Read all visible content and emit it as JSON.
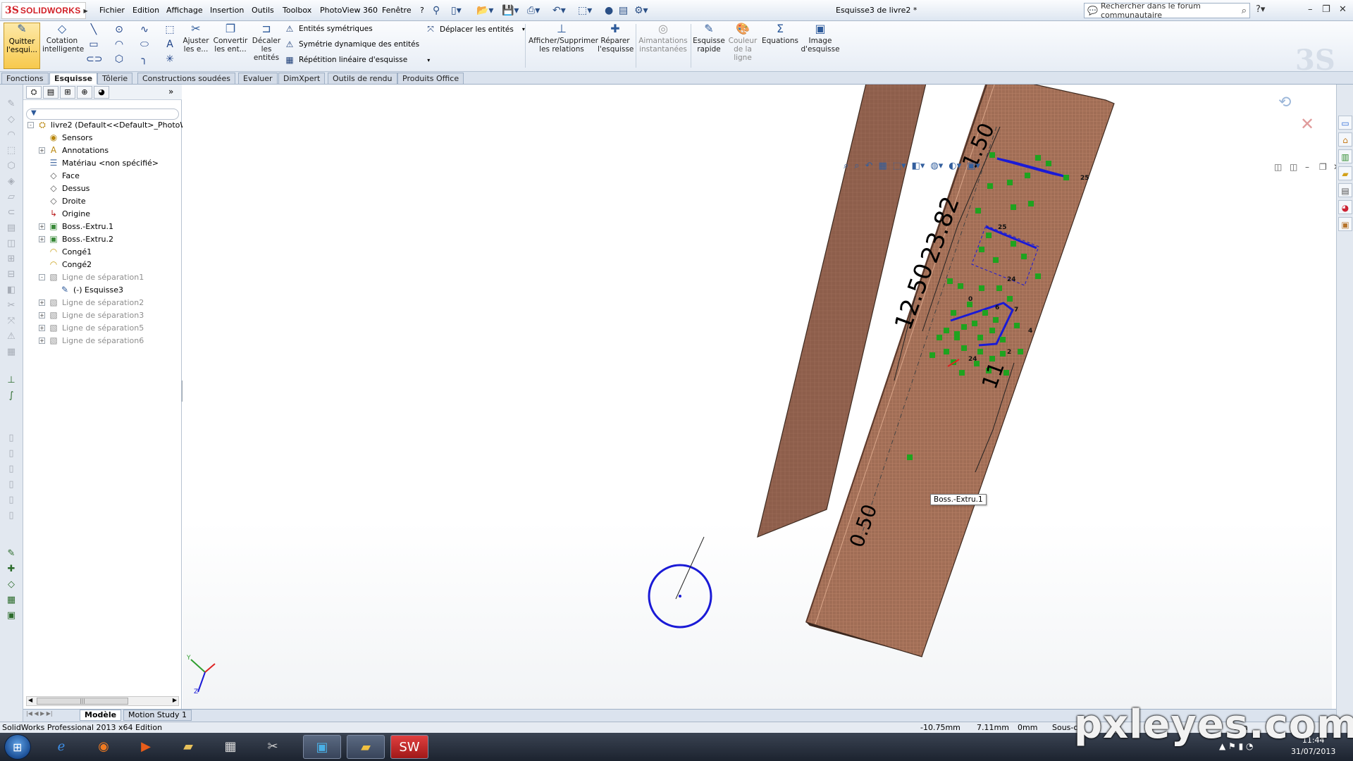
{
  "app": {
    "logo_ds": "3S",
    "logo_name": "SOLIDWORKS",
    "doc_title": "Esquisse3 de livre2 *",
    "search_placeholder": "Rechercher dans le forum communautaire"
  },
  "menu": [
    "Fichier",
    "Edition",
    "Affichage",
    "Insertion",
    "Outils",
    "Toolbox",
    "PhotoView 360",
    "Fenêtre",
    "?"
  ],
  "ribbon": {
    "quit_sketch": "Quitter l'esqui...",
    "smart_dim": "Cotation intelligente",
    "trim": "Ajuster les e...",
    "convert": "Convertir les ent...",
    "offset": "Décaler les entités",
    "mirror": "Entités symétriques",
    "dyn_mirror": "Symétrie dynamique des entités",
    "linear_pattern": "Répétition linéaire d'esquisse",
    "move": "Déplacer les entités",
    "show_rel": "Afficher/Supprimer les relations",
    "repair": "Réparer l'esquisse",
    "snaps": "Aimantations instantanées",
    "quick_sketch": "Esquisse rapide",
    "line_color": "Couleur de la ligne",
    "equations": "Equations",
    "sketch_pic": "Image d'esquisse"
  },
  "tabs": [
    "Fonctions",
    "Esquisse",
    "Tôlerie",
    "Constructions soudées",
    "Evaluer",
    "DimXpert",
    "Outils de rendu",
    "Produits Office"
  ],
  "active_tab": "Esquisse",
  "tree": [
    {
      "label": "livre2  (Default<<Default>_PhotoWo",
      "indent": 0,
      "icon": "part-icon",
      "expander": "-",
      "grey": false
    },
    {
      "label": "Sensors",
      "indent": 1,
      "icon": "sensors-icon",
      "expander": "",
      "grey": false
    },
    {
      "label": "Annotations",
      "indent": 1,
      "icon": "annotations-icon",
      "expander": "+",
      "grey": false
    },
    {
      "label": "Matériau <non spécifié>",
      "indent": 1,
      "icon": "material-icon",
      "expander": "",
      "grey": false
    },
    {
      "label": "Face",
      "indent": 1,
      "icon": "plane-icon",
      "expander": "",
      "grey": false
    },
    {
      "label": "Dessus",
      "indent": 1,
      "icon": "plane-icon",
      "expander": "",
      "grey": false
    },
    {
      "label": "Droite",
      "indent": 1,
      "icon": "plane-icon",
      "expander": "",
      "grey": false
    },
    {
      "label": "Origine",
      "indent": 1,
      "icon": "origin-icon",
      "expander": "",
      "grey": false
    },
    {
      "label": "Boss.-Extru.1",
      "indent": 1,
      "icon": "extrude-icon",
      "expander": "+",
      "grey": false
    },
    {
      "label": "Boss.-Extru.2",
      "indent": 1,
      "icon": "extrude-icon",
      "expander": "+",
      "grey": false
    },
    {
      "label": "Congé1",
      "indent": 1,
      "icon": "fillet-icon",
      "expander": "",
      "grey": false
    },
    {
      "label": "Congé2",
      "indent": 1,
      "icon": "fillet-icon",
      "expander": "",
      "grey": false
    },
    {
      "label": "Ligne de séparation1",
      "indent": 1,
      "icon": "split-line-icon",
      "expander": "-",
      "grey": true
    },
    {
      "label": "(-) Esquisse3",
      "indent": 2,
      "icon": "sketch-icon",
      "expander": "",
      "grey": false
    },
    {
      "label": "Ligne de séparation2",
      "indent": 1,
      "icon": "split-line-icon",
      "expander": "+",
      "grey": true
    },
    {
      "label": "Ligne de séparation3",
      "indent": 1,
      "icon": "split-line-icon",
      "expander": "+",
      "grey": true
    },
    {
      "label": "Ligne de séparation5",
      "indent": 1,
      "icon": "split-line-icon",
      "expander": "+",
      "grey": true
    },
    {
      "label": "Ligne de séparation6",
      "indent": 1,
      "icon": "split-line-icon",
      "expander": "+",
      "grey": true
    }
  ],
  "viewport": {
    "dims": [
      "1.50",
      "23.82",
      "12.50",
      "11",
      "0.50"
    ],
    "small_labels": [
      "25",
      "25",
      "24",
      "24",
      "4",
      "2",
      "0",
      "6",
      "7"
    ],
    "tooltip": "Boss.-Extru.1",
    "colors": {
      "wood": "#8a5a48",
      "wood_dark": "#6e4538",
      "sketch": "#1a1ad6",
      "relation": "#1fa31f",
      "dim": "#000000"
    }
  },
  "bottom_tabs": [
    "Modèle",
    "Motion Study 1"
  ],
  "status": {
    "edition": "SolidWorks Professional 2013 x64 Edition",
    "x": "-10.75mm",
    "y": "7.11mm",
    "z": "0mm",
    "state": "Sous-c",
    "tail": "onn"
  },
  "taskbar": {
    "time": "11:44",
    "date": "31/07/2013"
  },
  "watermark": "pxleyes.com"
}
